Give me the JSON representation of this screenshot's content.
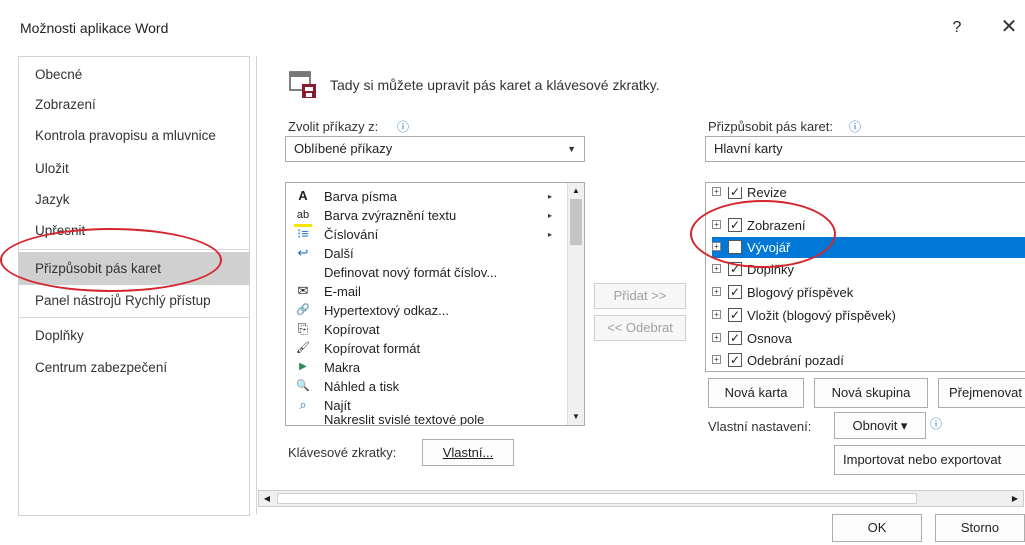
{
  "window": {
    "title": "Možnosti aplikace Word",
    "help": "?",
    "close": "✕"
  },
  "sidebar": {
    "items": [
      {
        "label": "Obecné"
      },
      {
        "label": "Zobrazení"
      },
      {
        "label": "Kontrola pravopisu a mluvnice"
      },
      {
        "label": "Uložit"
      },
      {
        "label": "Jazyk"
      },
      {
        "label": "Upřesnit"
      },
      {
        "label": "Přizpůsobit pás karet",
        "active": true
      },
      {
        "label": "Panel nástrojů Rychlý přístup"
      },
      {
        "label": "Doplňky"
      },
      {
        "label": "Centrum zabezpečení"
      }
    ]
  },
  "header": {
    "text": "Tady si můžete upravit pás karet a klávesové zkratky."
  },
  "left": {
    "choose_label": "Zvolit příkazy z:",
    "choose_value": "Oblíbené příkazy",
    "commands": [
      {
        "icon": "A",
        "label": "Barva písma",
        "sub": "▸"
      },
      {
        "icon": "ab",
        "label": "Barva zvýraznění textu",
        "sub": "▸"
      },
      {
        "icon": "⁝≡",
        "label": "Číslování",
        "sub": "▸"
      },
      {
        "icon": "↩",
        "label": "Další",
        "sub": ""
      },
      {
        "icon": "",
        "label": "Definovat nový formát číslov...",
        "sub": ""
      },
      {
        "icon": "✉",
        "label": "E-mail",
        "sub": ""
      },
      {
        "icon": "🔗",
        "label": "Hypertextový odkaz...",
        "sub": ""
      },
      {
        "icon": "⎘",
        "label": "Kopírovat",
        "sub": ""
      },
      {
        "icon": "🖌",
        "label": "Kopírovat formát",
        "sub": ""
      },
      {
        "icon": "▶",
        "label": "Makra",
        "sub": ""
      },
      {
        "icon": "🔍",
        "label": "Náhled a tisk",
        "sub": ""
      },
      {
        "icon": "⌕",
        "label": "Najít",
        "sub": ""
      },
      {
        "icon": "",
        "label": "Nakreslit svislé textové pole",
        "sub": ""
      }
    ],
    "shortcut_label": "Klávesové zkratky:",
    "shortcut_button": "Vlastní..."
  },
  "middle": {
    "add": "Přidat >>",
    "remove": "<< Odebrat"
  },
  "right": {
    "customize_label": "Přizpůsobit pás karet:",
    "customize_value": "Hlavní karty",
    "tree": [
      {
        "label": "Revize",
        "checked": true
      },
      {
        "label": "Zobrazení",
        "checked": true
      },
      {
        "label": "Vývojář",
        "checked": false,
        "selected": true
      },
      {
        "label": "Doplňky",
        "checked": true
      },
      {
        "label": "Blogový příspěvek",
        "checked": true
      },
      {
        "label": "Vložit (blogový příspěvek)",
        "checked": true
      },
      {
        "label": "Osnova",
        "checked": true
      },
      {
        "label": "Odebrání pozadí",
        "checked": true
      }
    ],
    "new_tab": "Nová karta",
    "new_group": "Nová skupina",
    "rename": "Přejmenovat",
    "custom_label": "Vlastní nastavení:",
    "reset": "Obnovit ▾",
    "import_export": "Importovat nebo exportovat"
  },
  "footer": {
    "ok": "OK",
    "cancel": "Storno"
  },
  "info_icon": "ⓘ",
  "colors": {
    "selection": "#0078d7",
    "annotation": "#d4262c"
  }
}
